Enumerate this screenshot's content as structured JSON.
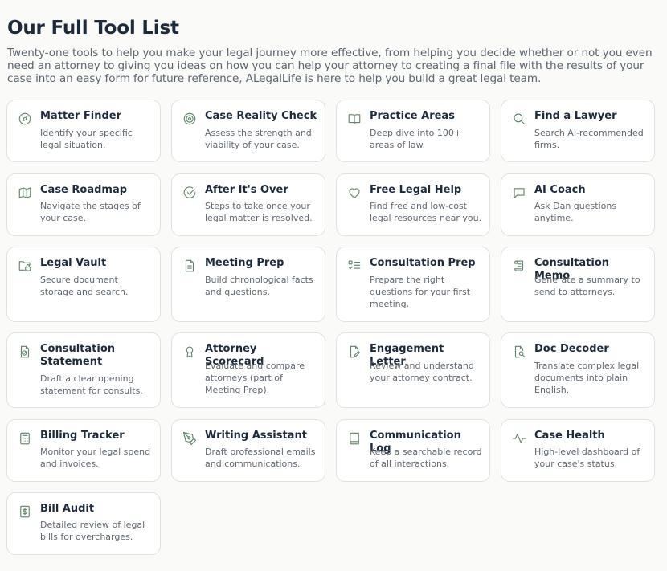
{
  "page": {
    "title": "Our Full Tool List",
    "intro": "Twenty-one tools to help you make your legal journey more effective, from helping you decide whether or not you even need an attorney to giving you ideas on how you can help your attorney to creating a final file with the results of your case into an easy form for future reference, ALegalLife is here to help you build a great legal team."
  },
  "colors": {
    "accent": "#5f8467",
    "title": "#1c2a3b",
    "muted": "#5f676f",
    "border": "#dfe2dd"
  },
  "tools": [
    {
      "title": "Matter Finder",
      "description": "Identify your specific legal situation.",
      "icon": "compass-icon"
    },
    {
      "title": "Case Reality Check",
      "description": "Assess the strength and viability of your case.",
      "icon": "target-icon"
    },
    {
      "title": "Practice Areas",
      "description": "Deep dive into 100+ areas of law.",
      "icon": "book-open-icon"
    },
    {
      "title": "Find a Lawyer",
      "description": "Search AI-recommended firms.",
      "icon": "search-icon"
    },
    {
      "title": "Case Roadmap",
      "description": "Navigate the stages of your case.",
      "icon": "map-icon"
    },
    {
      "title": "After It's Over",
      "description": "Steps to take once your legal matter is resolved.",
      "icon": "check-circle-icon"
    },
    {
      "title": "Free Legal Help",
      "description": "Find free and low-cost legal resources near you.",
      "icon": "heart-icon"
    },
    {
      "title": "AI Coach",
      "description": "Ask Dan questions anytime.",
      "icon": "message-square-icon"
    },
    {
      "title": "Legal Vault",
      "description": "Secure document storage and search.",
      "icon": "folder-lock-icon"
    },
    {
      "title": "Meeting Prep",
      "description": "Build chronological facts and questions.",
      "icon": "file-text-icon"
    },
    {
      "title": "Consultation Prep",
      "description": "Prepare the right questions for your first meeting.",
      "icon": "list-checks-icon"
    },
    {
      "title": "Consultation Memo",
      "description": "Generate a summary to send to attorneys.",
      "icon": "scroll-icon"
    },
    {
      "title": "Consultation Statement",
      "description": "Draft a clear opening statement for consults.",
      "icon": "file-check-icon"
    },
    {
      "title": "Attorney Scorecard",
      "description": "Evaluate and compare attorneys (part of Meeting Prep).",
      "icon": "award-icon"
    },
    {
      "title": "Engagement Letter",
      "description": "Review and understand your attorney contract.",
      "icon": "file-signature-icon"
    },
    {
      "title": "Doc Decoder",
      "description": "Translate complex legal documents into plain English.",
      "icon": "file-search-icon"
    },
    {
      "title": "Billing Tracker",
      "description": "Monitor your legal spend and invoices.",
      "icon": "calculator-icon"
    },
    {
      "title": "Writing Assistant",
      "description": "Draft professional emails and communications.",
      "icon": "pen-tool-icon"
    },
    {
      "title": "Communication Log",
      "description": "Keep a searchable record of all interactions.",
      "icon": "notebook-icon"
    },
    {
      "title": "Case Health",
      "description": "High-level dashboard of your case's status.",
      "icon": "activity-icon"
    },
    {
      "title": "Bill Audit",
      "description": "Detailed review of legal bills for overcharges.",
      "icon": "receipt-dollar-icon"
    }
  ]
}
